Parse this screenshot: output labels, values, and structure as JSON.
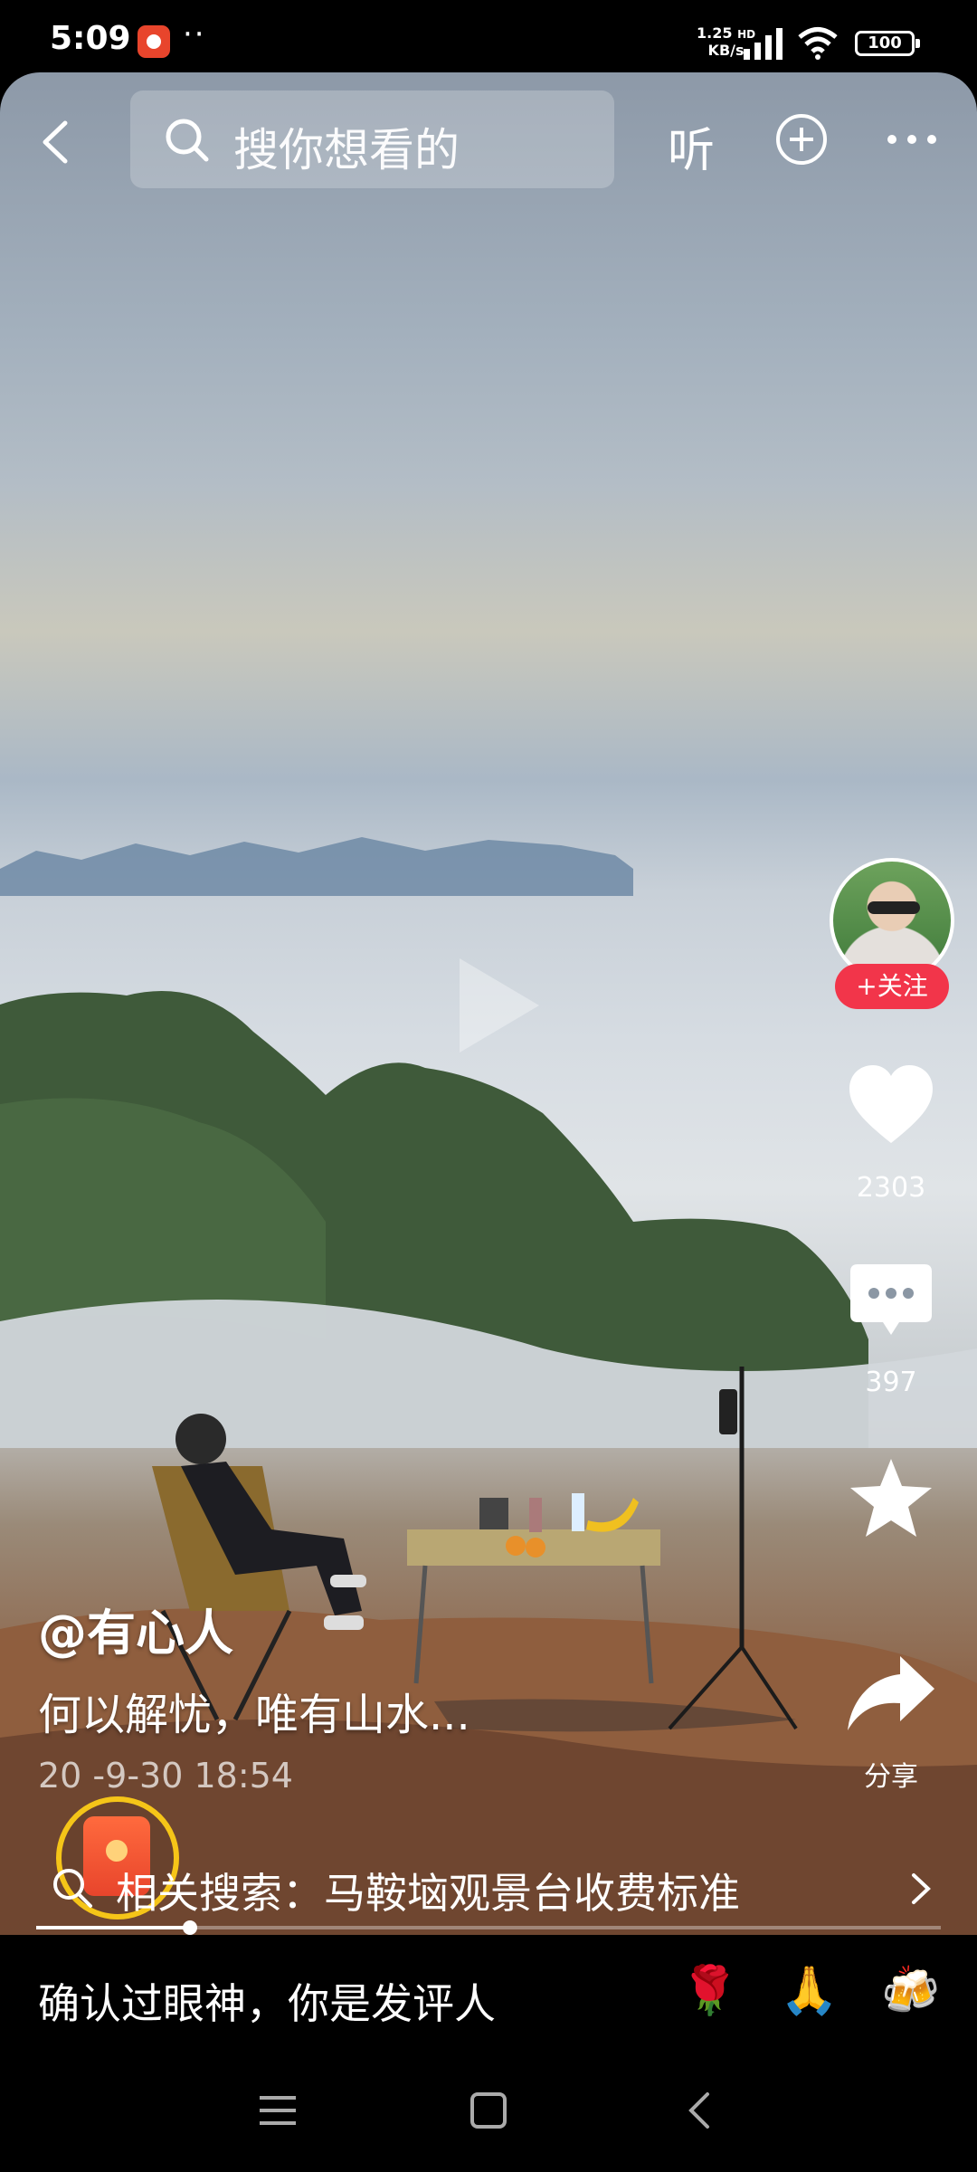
{
  "status_bar": {
    "time": "5:09",
    "dots": "··",
    "net_speed_value": "1.25",
    "net_speed_unit": "KB/s",
    "hd_label": "HD",
    "battery": "100"
  },
  "top_bar": {
    "search_placeholder": "搜你想看的",
    "listen_label": "听"
  },
  "post": {
    "author": "@有心人",
    "caption": "何以解忧，唯有山水...",
    "date": "20  -9-30 18:54"
  },
  "right_rail": {
    "follow_label": "+关注",
    "like_count": "2303",
    "comment_count": "397",
    "share_label": "分享"
  },
  "related_search": {
    "text": "相关搜索：马鞍垴观景台收费标准"
  },
  "progress": {
    "played_fraction": 0.17
  },
  "comment_bar": {
    "placeholder": "确认过眼神，你是发评人",
    "emojis": [
      "🌹",
      "🙏",
      "🍻"
    ]
  },
  "colors": {
    "follow_red": "#f2354a",
    "ring_yellow": "#f5c518",
    "red_packet": "#e8452c"
  }
}
